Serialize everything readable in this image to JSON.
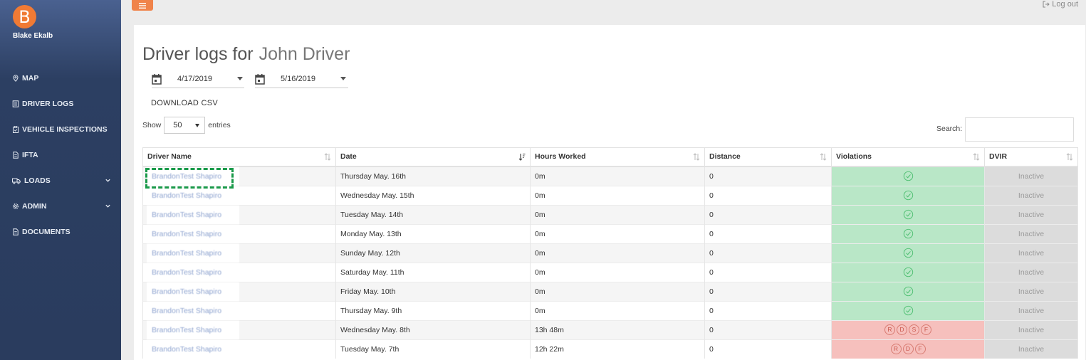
{
  "user": {
    "avatar_letter": "B",
    "name": "Blake Ekalb"
  },
  "sidebar": {
    "items": [
      {
        "label": "MAP",
        "icon": "map-pin-icon"
      },
      {
        "label": "DRIVER LOGS",
        "icon": "log-book-icon"
      },
      {
        "label": "VEHICLE INSPECTIONS",
        "icon": "clipboard-icon"
      },
      {
        "label": "IFTA",
        "icon": "document-icon"
      },
      {
        "label": "LOADS",
        "icon": "truck-icon"
      },
      {
        "label": "ADMIN",
        "icon": "gear-icon"
      },
      {
        "label": "DOCUMENTS",
        "icon": "document-icon"
      }
    ]
  },
  "topbar": {
    "logout_label": "Log out"
  },
  "page": {
    "title_prefix": "Driver logs for",
    "driver_name": "John Driver",
    "start_date": "4/17/2019",
    "end_date": "5/16/2019",
    "download_label": "DOWNLOAD CSV",
    "show_label": "Show",
    "entries_value": "50",
    "entries_label": "entries",
    "search_label": "Search:"
  },
  "table": {
    "columns": [
      "Driver Name",
      "Date",
      "Hours Worked",
      "Distance",
      "Violations",
      "DVIR"
    ],
    "rows": [
      {
        "driver": "BrandonTest Shapiro",
        "date": "Thursday May. 16th",
        "hours": "0m",
        "distance": "0",
        "violations": [],
        "dvir": "Inactive"
      },
      {
        "driver": "BrandonTest Shapiro",
        "date": "Wednesday May. 15th",
        "hours": "0m",
        "distance": "0",
        "violations": [],
        "dvir": "Inactive"
      },
      {
        "driver": "BrandonTest Shapiro",
        "date": "Tuesday May. 14th",
        "hours": "0m",
        "distance": "0",
        "violations": [],
        "dvir": "Inactive"
      },
      {
        "driver": "BrandonTest Shapiro",
        "date": "Monday May. 13th",
        "hours": "0m",
        "distance": "0",
        "violations": [],
        "dvir": "Inactive"
      },
      {
        "driver": "BrandonTest Shapiro",
        "date": "Sunday May. 12th",
        "hours": "0m",
        "distance": "0",
        "violations": [],
        "dvir": "Inactive"
      },
      {
        "driver": "BrandonTest Shapiro",
        "date": "Saturday May. 11th",
        "hours": "0m",
        "distance": "0",
        "violations": [],
        "dvir": "Inactive"
      },
      {
        "driver": "BrandonTest Shapiro",
        "date": "Friday May. 10th",
        "hours": "0m",
        "distance": "0",
        "violations": [],
        "dvir": "Inactive"
      },
      {
        "driver": "BrandonTest Shapiro",
        "date": "Thursday May. 9th",
        "hours": "0m",
        "distance": "0",
        "violations": [],
        "dvir": "Inactive"
      },
      {
        "driver": "BrandonTest Shapiro",
        "date": "Wednesday May. 8th",
        "hours": "13h 48m",
        "distance": "0",
        "violations": [
          "R",
          "D",
          "S",
          "F"
        ],
        "dvir": "Inactive"
      },
      {
        "driver": "BrandonTest Shapiro",
        "date": "Tuesday May. 7th",
        "hours": "12h 22m",
        "distance": "0",
        "violations": [
          "R",
          "D",
          "F"
        ],
        "dvir": "Inactive"
      }
    ]
  },
  "colors": {
    "sidebar_bg": "#2a3c5e",
    "accent_orange": "#f0834a",
    "violation_ok": "#b9e7c7",
    "violation_bad": "#f6c0bd",
    "dvir_inactive": "#dcdcdc",
    "highlight": "#1a9a4a"
  }
}
